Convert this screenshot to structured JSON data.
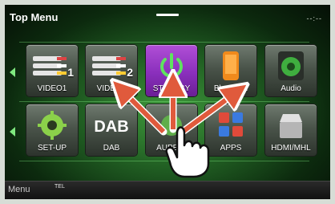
{
  "header": {
    "title": "Top Menu",
    "clock": "--:--"
  },
  "tiles_row1": [
    {
      "label": "VIDEO1",
      "badge": "1",
      "icon": "rca-connector-icon"
    },
    {
      "label": "VIDEO2",
      "badge": "2",
      "icon": "rca-connector-icon"
    },
    {
      "label": "STANDBY",
      "icon": "power-icon"
    },
    {
      "label": "Bluetooth",
      "icon": "phone-icon"
    },
    {
      "label": "Audio",
      "icon": "speaker-icon"
    }
  ],
  "tiles_row2": [
    {
      "label": "SET-UP",
      "icon": "gear-icon"
    },
    {
      "label": "DAB",
      "icon": "dab-icon"
    },
    {
      "label": "AUPEO!",
      "icon": "aupeo-icon"
    },
    {
      "label": "APPS",
      "icon": "apps-grid-icon"
    },
    {
      "label": "HDMI/MHL",
      "icon": "hdmi-icon"
    }
  ],
  "bottom_bar": {
    "menu_label": "Menu",
    "tel_label": "TEL"
  },
  "colors": {
    "active_tile": "#8a2fbc",
    "arrow": "#e05a3c",
    "background": "#205d22"
  }
}
